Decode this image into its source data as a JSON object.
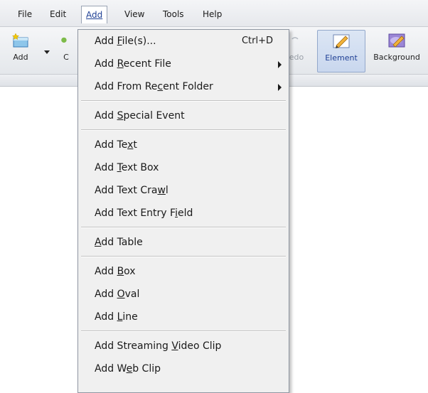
{
  "menubar": {
    "items": [
      "File",
      "Edit",
      "Add",
      "View",
      "Tools",
      "Help"
    ]
  },
  "toolbar": {
    "add_label": "Add",
    "c_label": "C",
    "redo_label": "edo",
    "element_label": "Element",
    "background_label": "Background"
  },
  "add_menu": {
    "items": [
      {
        "pre": "Add ",
        "u": "F",
        "post": "ile(s)...",
        "shortcut": "Ctrl+D"
      },
      {
        "pre": "Add ",
        "u": "R",
        "post": "ecent File",
        "submenu": true
      },
      {
        "pre": "Add From Re",
        "u": "c",
        "post": "ent Folder",
        "submenu": true
      },
      {
        "pre": "Add ",
        "u": "S",
        "post": "pecial Event"
      },
      {
        "pre": "Add Te",
        "u": "x",
        "post": "t"
      },
      {
        "pre": "Add ",
        "u": "T",
        "post": "ext Box"
      },
      {
        "pre": "Add Text Cra",
        "u": "w",
        "post": "l"
      },
      {
        "pre": "Add Text Entry F",
        "u": "i",
        "post": "eld"
      },
      {
        "pre": "",
        "u": "A",
        "post": "dd Table"
      },
      {
        "pre": "Add ",
        "u": "B",
        "post": "ox"
      },
      {
        "pre": "Add ",
        "u": "O",
        "post": "val"
      },
      {
        "pre": "Add ",
        "u": "L",
        "post": "ine"
      },
      {
        "pre": "Add Streaming ",
        "u": "V",
        "post": "ideo Clip"
      },
      {
        "pre": "Add W",
        "u": "e",
        "post": "b Clip"
      }
    ]
  }
}
